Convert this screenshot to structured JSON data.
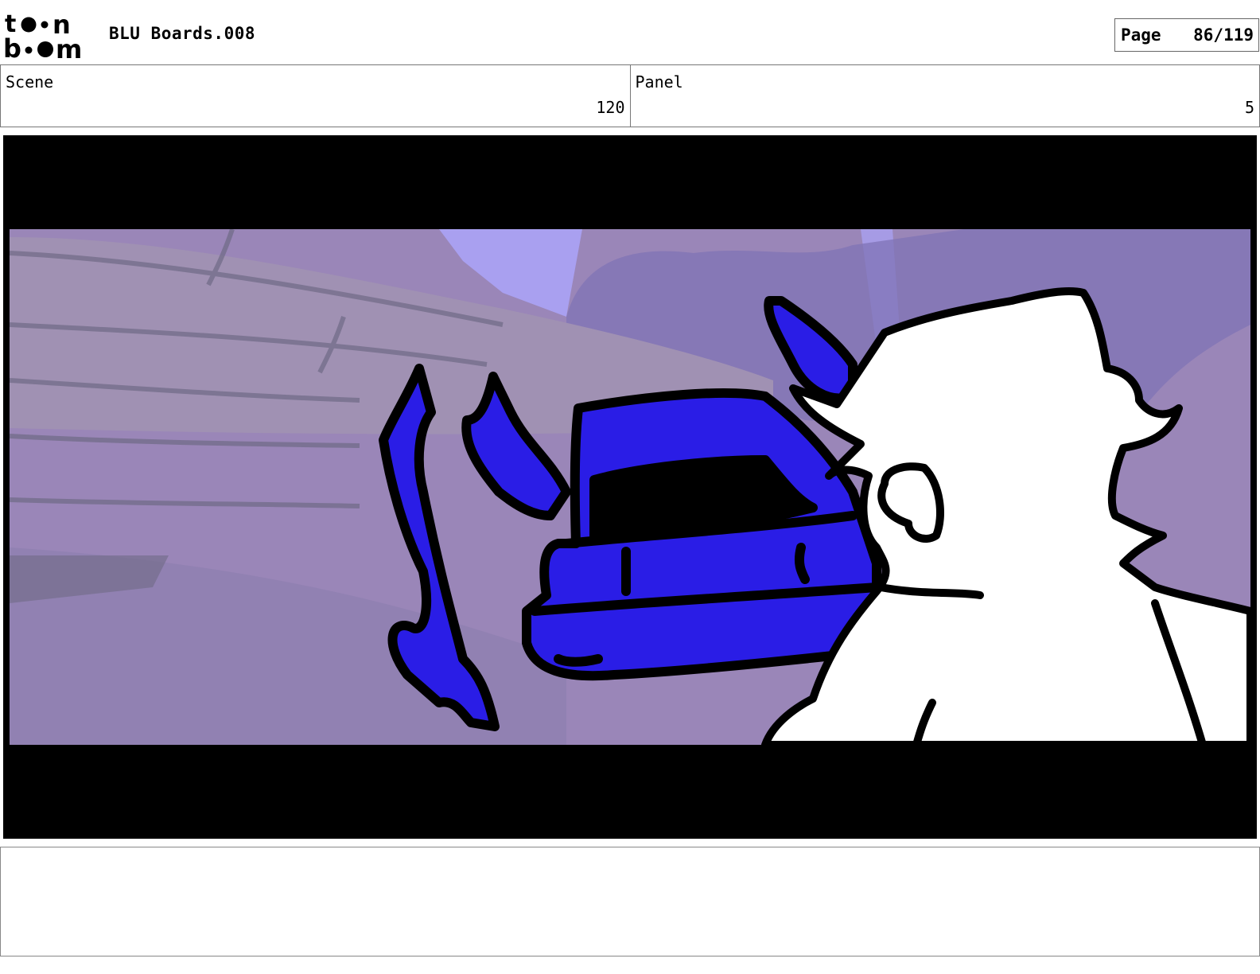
{
  "header": {
    "logo": {
      "text_top": "toon",
      "text_bottom": "boom",
      "icon": "toonboom-logo"
    },
    "title": "BLU Boards.008",
    "page_label": "Page",
    "page_number": "86/119"
  },
  "scene": {
    "label": "Scene",
    "value": "120"
  },
  "panel": {
    "label": "Panel",
    "value": "5"
  },
  "artwork": {
    "icon": "storyboard-panel-drawing",
    "colors": {
      "letterbox": "#000000",
      "background": "#9a86b8",
      "sky": "#a9a0f0",
      "creature_fill": "#2a1de6",
      "character_fill": "#ffffff",
      "outline": "#000000"
    }
  },
  "notes": {
    "text": ""
  }
}
